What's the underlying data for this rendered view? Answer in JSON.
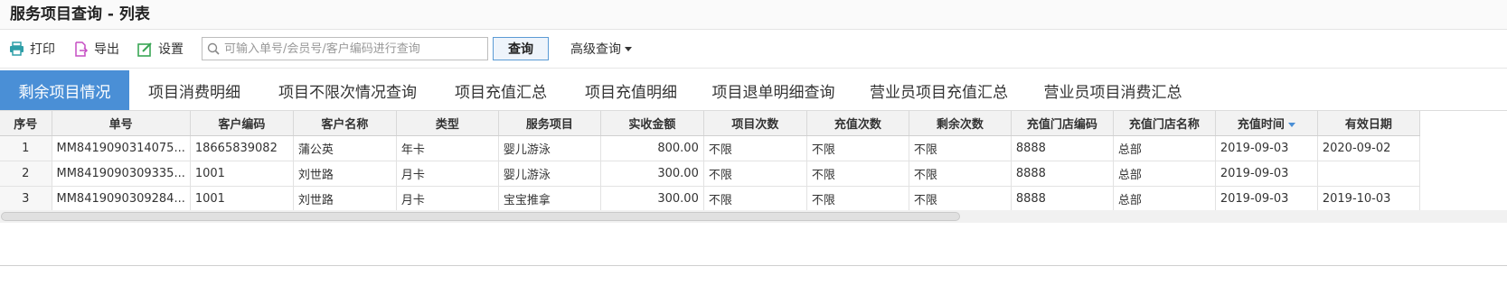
{
  "page": {
    "title": "服务项目查询 - 列表"
  },
  "toolbar": {
    "print_label": "打印",
    "export_label": "导出",
    "settings_label": "设置",
    "search_placeholder": "可输入单号/会员号/客户编码进行查询",
    "search_value": "",
    "query_label": "查询",
    "advanced_label": "高级查询"
  },
  "tabs": [
    {
      "label": "剩余项目情况",
      "active": true
    },
    {
      "label": "项目消费明细",
      "active": false
    },
    {
      "label": "项目不限次情况查询",
      "active": false
    },
    {
      "label": "项目充值汇总",
      "active": false
    },
    {
      "label": "项目充值明细",
      "active": false
    },
    {
      "label": "项目退单明细查询",
      "active": false
    },
    {
      "label": "营业员项目充值汇总",
      "active": false
    },
    {
      "label": "营业员项目消费汇总",
      "active": false
    }
  ],
  "table": {
    "columns": [
      "序号",
      "单号",
      "客户编码",
      "客户名称",
      "类型",
      "服务项目",
      "实收金额",
      "项目次数",
      "充值次数",
      "剩余次数",
      "充值门店编码",
      "充值门店名称",
      "充值时间",
      "有效日期"
    ],
    "sorted_column": "充值时间",
    "rows": [
      [
        "1",
        "MM8419090314075...",
        "18665839082",
        "蒲公英",
        "年卡",
        "婴儿游泳",
        "800.00",
        "不限",
        "不限",
        "不限",
        "8888",
        "总部",
        "2019-09-03",
        "2020-09-02"
      ],
      [
        "2",
        "MM8419090309335...",
        "1001",
        "刘世路",
        "月卡",
        "婴儿游泳",
        "300.00",
        "不限",
        "不限",
        "不限",
        "8888",
        "总部",
        "2019-09-03",
        ""
      ],
      [
        "3",
        "MM8419090309284...",
        "1001",
        "刘世路",
        "月卡",
        "宝宝推拿",
        "300.00",
        "不限",
        "不限",
        "不限",
        "8888",
        "总部",
        "2019-09-03",
        "2019-10-03"
      ]
    ]
  },
  "colors": {
    "accent": "#4a8fd6",
    "print_icon": "#2f9fa8",
    "export_icon": "#c64ec4",
    "settings_icon": "#3aa655"
  },
  "icons": {
    "print": "printer-icon",
    "export": "export-icon",
    "settings": "edit-settings-icon",
    "search": "search-icon"
  }
}
